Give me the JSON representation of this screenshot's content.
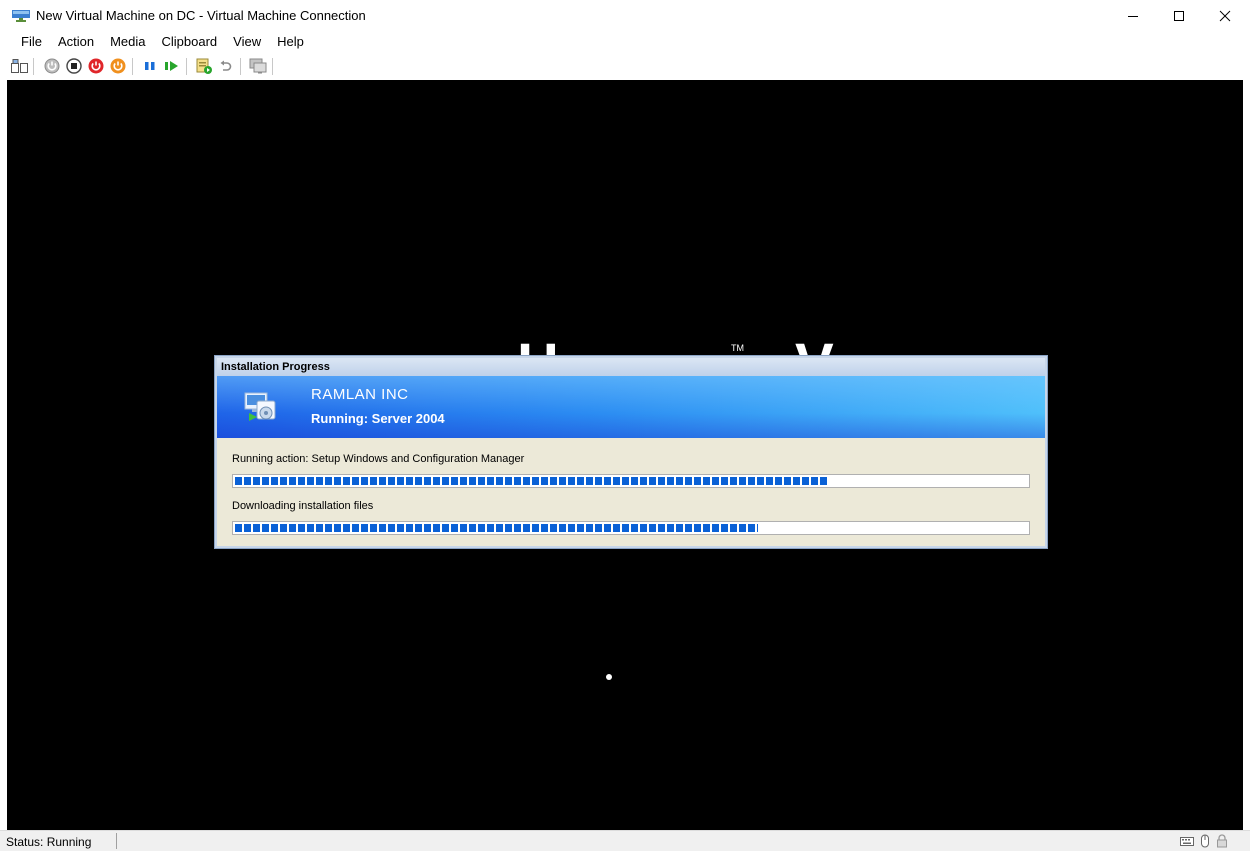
{
  "window": {
    "title": "New Virtual Machine on DC - Virtual Machine Connection",
    "icon": "hyper-v-vm-icon"
  },
  "menu": {
    "items": [
      {
        "label": "File"
      },
      {
        "label": "Action"
      },
      {
        "label": "Media"
      },
      {
        "label": "Clipboard"
      },
      {
        "label": "View"
      },
      {
        "label": "Help"
      }
    ]
  },
  "toolbar": {
    "buttons": [
      {
        "name": "ctrl-alt-del-icon"
      },
      {
        "name": "start-icon"
      },
      {
        "name": "turn-off-icon"
      },
      {
        "name": "shut-down-icon"
      },
      {
        "name": "save-icon"
      },
      {
        "name": "pause-icon"
      },
      {
        "name": "resume-icon"
      },
      {
        "name": "checkpoint-icon"
      },
      {
        "name": "revert-icon"
      },
      {
        "name": "enhanced-session-icon"
      }
    ],
    "colors": {
      "red": "#e0262a",
      "orange": "#f0901e",
      "blue": "#1a6ed8",
      "green": "#28a52c",
      "gray": "#7a7a7a"
    }
  },
  "vm": {
    "background": "#000000",
    "logo_text": "H V",
    "logo_tm": "TM"
  },
  "dialog": {
    "caption": "Installation Progress",
    "org": "RAMLAN INC",
    "running": "Running: Server 2004",
    "progress": [
      {
        "label": "Running action: Setup Windows and Configuration Manager",
        "percent": 75
      },
      {
        "label": "Downloading installation files",
        "percent": 66
      }
    ],
    "colors": {
      "progress": "#0a61d6",
      "banner_start": "#1f64e8",
      "banner_end": "#4fc0fb"
    }
  },
  "status": {
    "text": "Status: Running",
    "icons": [
      "keyboard-icon",
      "mouse-icon",
      "lock-icon"
    ]
  }
}
